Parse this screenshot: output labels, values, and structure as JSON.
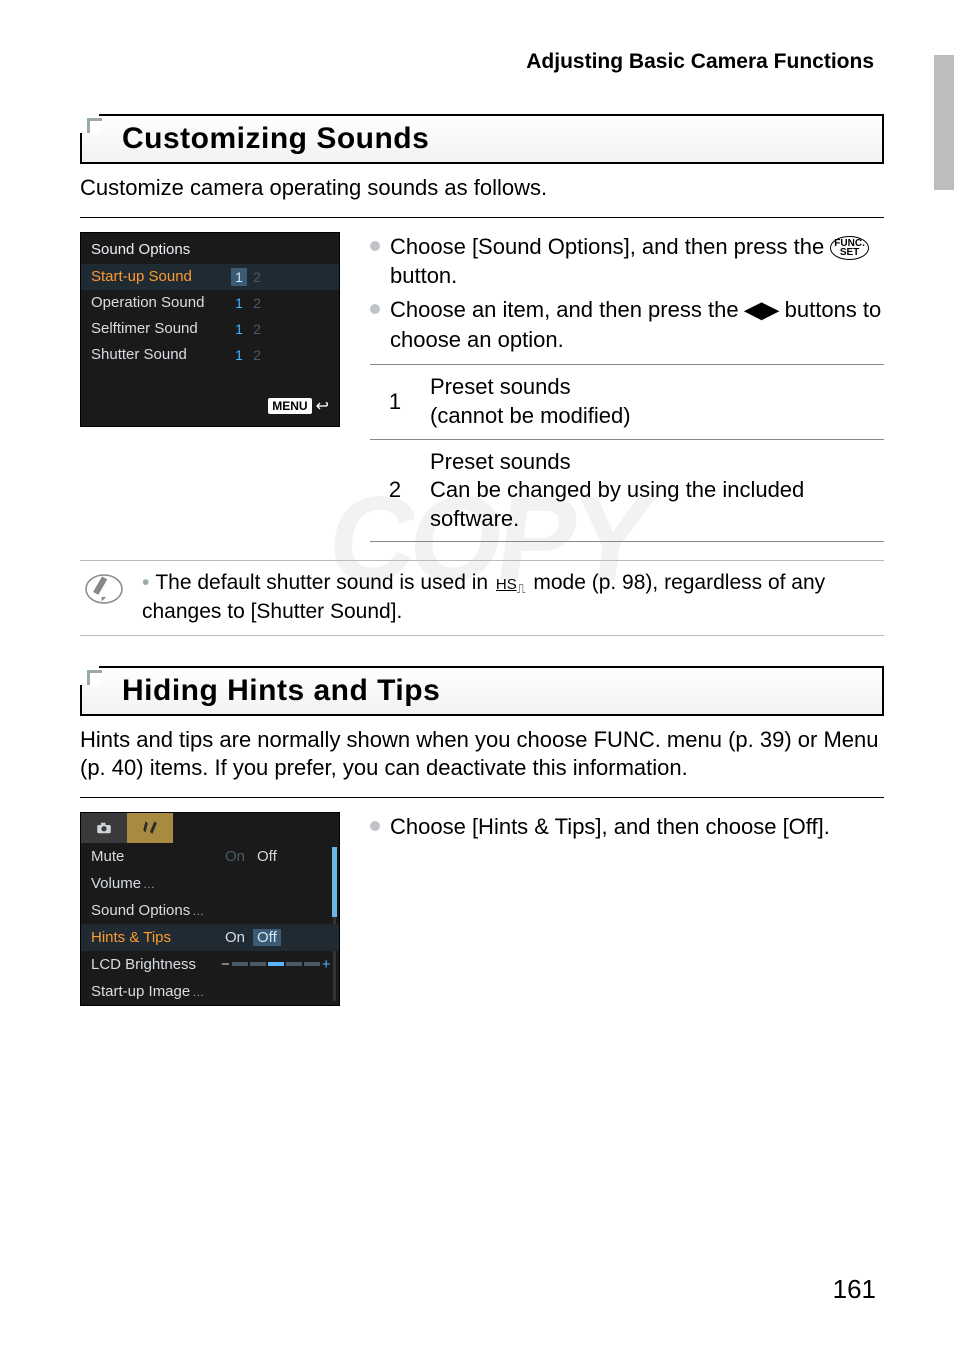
{
  "header": {
    "title": "Adjusting Basic Camera Functions"
  },
  "watermark": "COPY",
  "section1": {
    "heading": "Customizing Sounds",
    "intro": "Customize camera operating sounds as follows.",
    "camera": {
      "title": "Sound Options",
      "rows": [
        {
          "label": "Start-up Sound",
          "v1": "1",
          "v2": "2",
          "highlight": true
        },
        {
          "label": "Operation Sound",
          "v1": "1",
          "v2": "2",
          "highlight": false
        },
        {
          "label": "Selftimer Sound",
          "v1": "1",
          "v2": "2",
          "highlight": false
        },
        {
          "label": "Shutter Sound",
          "v1": "1",
          "v2": "2",
          "highlight": false
        }
      ],
      "menu_label": "MENU"
    },
    "instructions": {
      "line1a": "Choose [Sound Options], and then press the ",
      "line1b": " button.",
      "func_top": "FUNC.",
      "func_bot": "SET",
      "line2a": "Choose an item, and then press the ",
      "line2b": " buttons to choose an option.",
      "lr": "◀▶"
    },
    "table": {
      "r1n": "1",
      "r1a": "Preset sounds",
      "r1b": "(cannot be modified)",
      "r2n": "2",
      "r2a": "Preset sounds",
      "r2b": "Can be changed by using the included software."
    },
    "note": {
      "text_a": "The default shutter sound is used in ",
      "hs_icon": "HS",
      "text_b": " mode (p. 98), regardless of any changes to [Shutter Sound]."
    }
  },
  "section2": {
    "heading": "Hiding Hints and Tips",
    "intro": "Hints and tips are normally shown when you choose FUNC. menu (p. 39) or Menu (p. 40) items. If you prefer, you can deactivate this information.",
    "camera": {
      "rows": {
        "mute": {
          "label": "Mute",
          "on": "On",
          "off": "Off"
        },
        "volume": {
          "label": "Volume"
        },
        "sound_options": {
          "label": "Sound Options"
        },
        "hints": {
          "label": "Hints & Tips",
          "on": "On",
          "off": "Off"
        },
        "lcd": {
          "label": "LCD Brightness"
        },
        "startup": {
          "label": "Start-up Image"
        }
      }
    },
    "instruction": "Choose [Hints & Tips], and then choose [Off]."
  },
  "page_number": "161"
}
